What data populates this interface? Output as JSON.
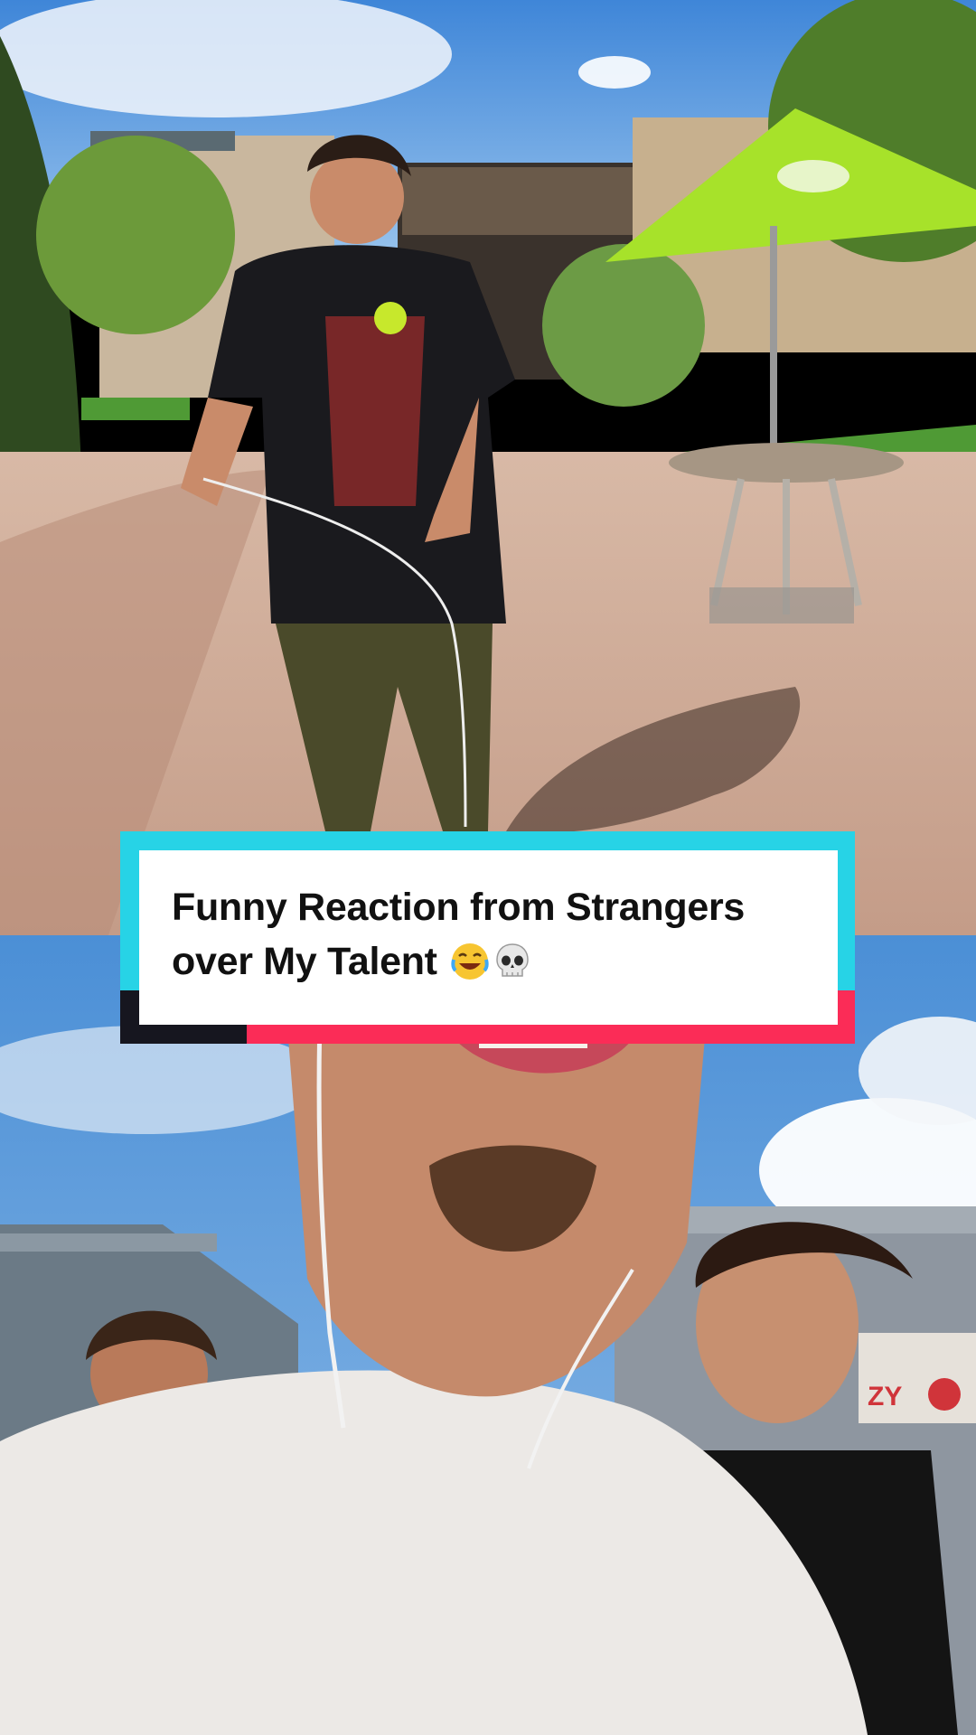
{
  "caption": {
    "line1": "Funny Reaction from Strangers",
    "line2": "over My Talent",
    "emojis": [
      "face-with-tears-of-joy",
      "skull"
    ]
  },
  "scene": {
    "top": {
      "description_icons": [
        "outdoor-plaza",
        "green-umbrella",
        "round-table",
        "person-yoyo-performer"
      ]
    },
    "bottom": {
      "store_sign": "ZY"
    }
  },
  "colors": {
    "caption_cyan": "#27d3e6",
    "caption_red": "#fb2c57",
    "caption_black": "#16161f",
    "umbrella_green": "#a7e22a",
    "sky_blue": "#4b8fd6"
  }
}
